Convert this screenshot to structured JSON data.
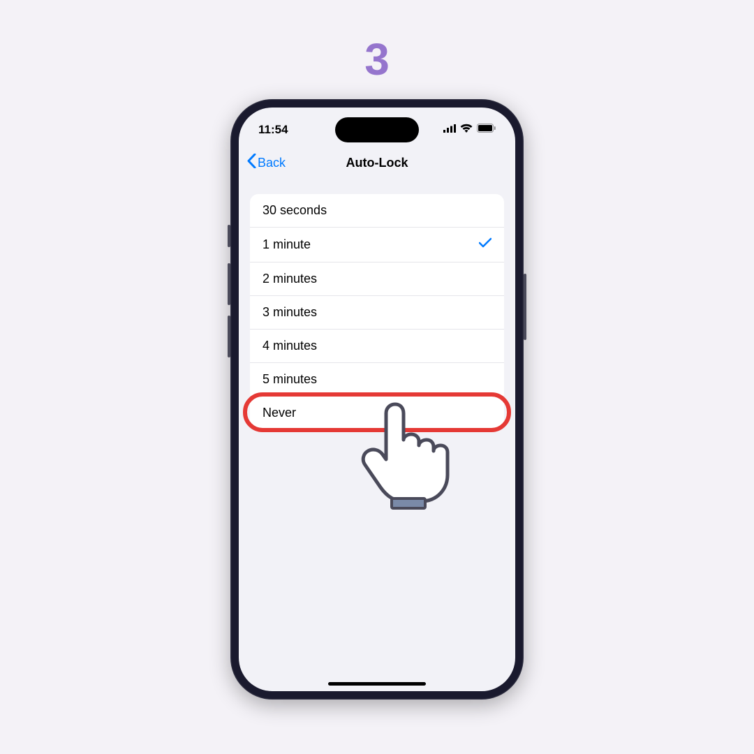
{
  "step_number": "3",
  "status_bar": {
    "time": "11:54"
  },
  "nav": {
    "back_label": "Back",
    "title": "Auto-Lock"
  },
  "options": [
    {
      "label": "30 seconds",
      "selected": false,
      "highlighted": false
    },
    {
      "label": "1 minute",
      "selected": true,
      "highlighted": false
    },
    {
      "label": "2 minutes",
      "selected": false,
      "highlighted": false
    },
    {
      "label": "3 minutes",
      "selected": false,
      "highlighted": false
    },
    {
      "label": "4 minutes",
      "selected": false,
      "highlighted": false
    },
    {
      "label": "5 minutes",
      "selected": false,
      "highlighted": false
    },
    {
      "label": "Never",
      "selected": false,
      "highlighted": true
    }
  ],
  "colors": {
    "accent": "#007aff",
    "highlight": "#e53935",
    "step": "#9575cd"
  }
}
